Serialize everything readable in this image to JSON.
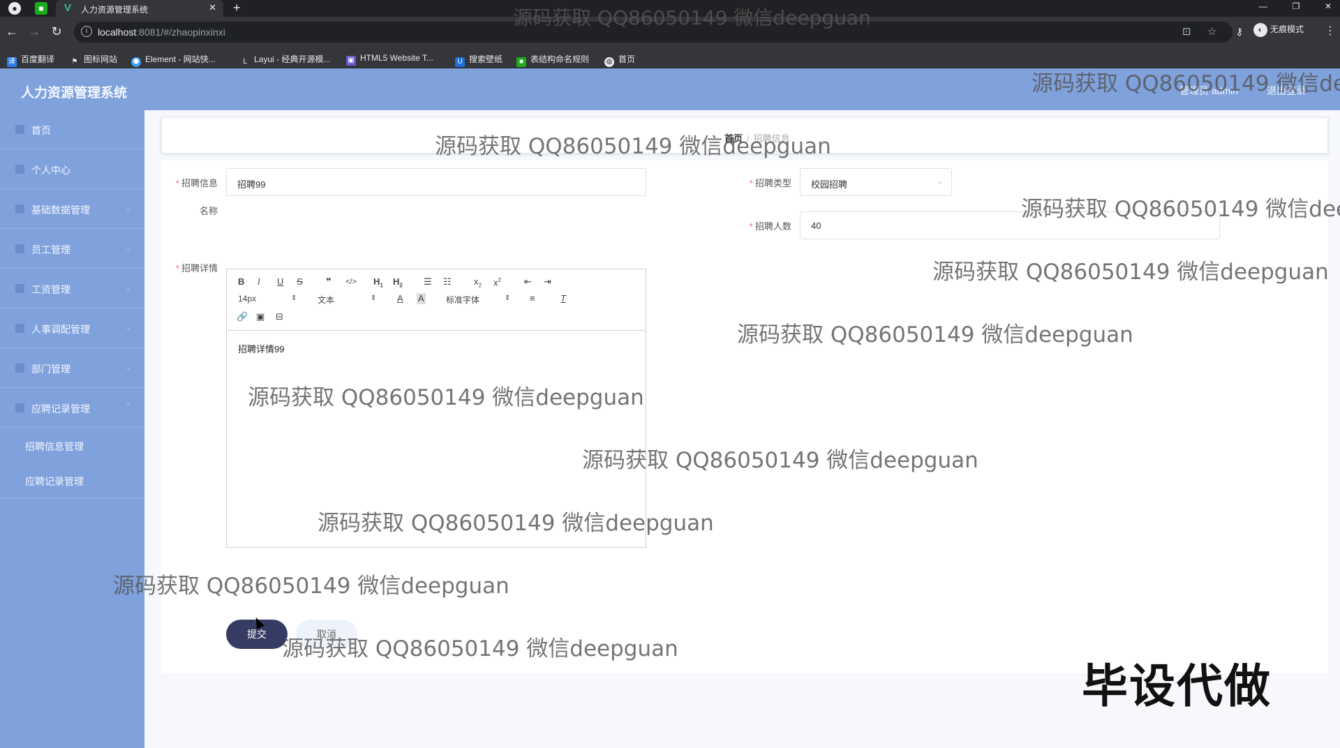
{
  "browser": {
    "tab_title": "人力资源管理系统",
    "url_host": "localhost",
    "url_rest": ":8081/#/zhaopinxinxi",
    "incognito_label": "无痕模式",
    "bookmarks": [
      "百度翻译",
      "图标网站",
      "Element - 网站快...",
      "Layui - 经典开源模...",
      "HTML5 Website T...",
      "搜索壁纸",
      "表结构命名规则",
      "首页"
    ]
  },
  "header": {
    "app_title": "人力资源管理系统",
    "admin_label": "管理员 admin",
    "logout_label": "退出登录"
  },
  "sidebar": {
    "items": [
      {
        "label": "首页",
        "icon": "home-icon"
      },
      {
        "label": "个人中心",
        "icon": "user-icon"
      },
      {
        "label": "基础数据管理",
        "icon": "grid-icon"
      },
      {
        "label": "员工管理",
        "icon": "staff-icon"
      },
      {
        "label": "工资管理",
        "icon": "salary-icon"
      },
      {
        "label": "人事调配管理",
        "icon": "transfer-icon"
      },
      {
        "label": "部门管理",
        "icon": "department-icon"
      },
      {
        "label": "应聘记录管理",
        "icon": "record-icon"
      }
    ],
    "sub_items": [
      "招聘信息管理",
      "应聘记录管理"
    ]
  },
  "breadcrumb": {
    "home": "首页",
    "separator": "/",
    "current": "招聘信息"
  },
  "form": {
    "name_label_line1": "招聘信息",
    "name_label_line2": "名称",
    "name_value": "招聘99",
    "type_label": "招聘类型",
    "type_value": "校园招聘",
    "count_label": "招聘人数",
    "count_value": "40",
    "detail_label": "招聘详情",
    "detail_content": "招聘详情99",
    "editor": {
      "font_size": "14px",
      "header_picker": "文本",
      "font_picker": "标准字体"
    },
    "submit_label": "提交",
    "cancel_label": "取消"
  },
  "watermark": {
    "text": "源码获取 QQ86050149 微信deepguan",
    "stamp": "毕设代做"
  }
}
